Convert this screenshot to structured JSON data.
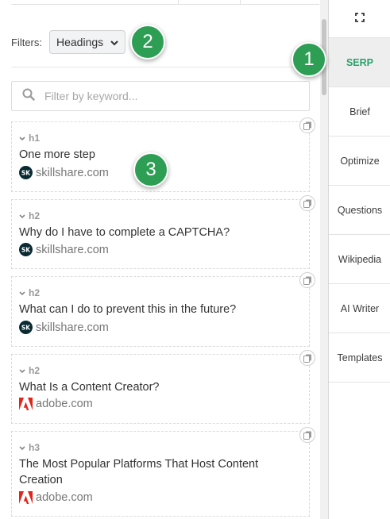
{
  "filters": {
    "label": "Filters:",
    "selected": "Headings"
  },
  "search": {
    "placeholder": "Filter by keyword..."
  },
  "cards": [
    {
      "tag": "h1",
      "text": "One more step",
      "source": "skillshare.com",
      "source_icon": "skillshare-icon"
    },
    {
      "tag": "h2",
      "text": "Why do I have to complete a CAPTCHA?",
      "source": "skillshare.com",
      "source_icon": "skillshare-icon"
    },
    {
      "tag": "h2",
      "text": "What can I do to prevent this in the future?",
      "source": "skillshare.com",
      "source_icon": "skillshare-icon"
    },
    {
      "tag": "h2",
      "text": "What Is a Content Creator?",
      "source": "adobe.com",
      "source_icon": "adobe-icon"
    },
    {
      "tag": "h3",
      "text": "The Most Popular Platforms That Host Content Creation",
      "source": "adobe.com",
      "source_icon": "adobe-icon"
    }
  ],
  "nav": {
    "expand_icon": "expand-icon",
    "items": [
      {
        "label": "SERP",
        "active": true
      },
      {
        "label": "Brief",
        "active": false
      },
      {
        "label": "Optimize",
        "active": false
      },
      {
        "label": "Questions",
        "active": false
      },
      {
        "label": "Wikipedia",
        "active": false
      },
      {
        "label": "AI Writer",
        "active": false
      },
      {
        "label": "Templates",
        "active": false
      }
    ]
  },
  "badges": [
    "1",
    "2",
    "3"
  ],
  "colors": {
    "accent": "#2aa26a",
    "badge": "#2f9e55",
    "skillshare": "#0a2a33",
    "adobe": "#e1251b"
  }
}
